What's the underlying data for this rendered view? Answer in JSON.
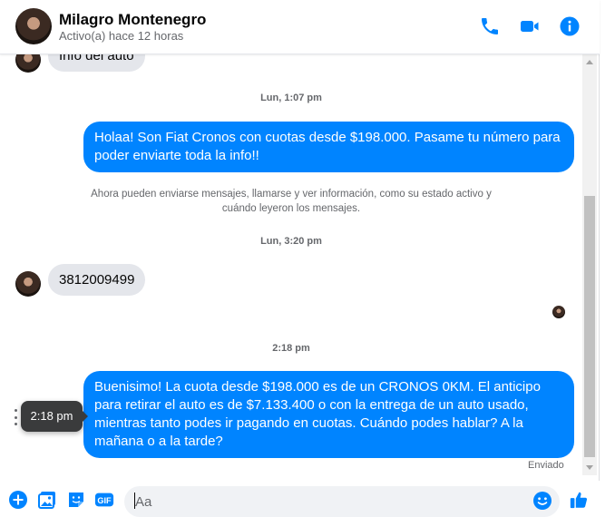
{
  "contact": {
    "name": "Milagro Montenegro",
    "status": "Activo(a) hace 12 horas"
  },
  "header_icons": [
    "phone-icon",
    "video-camera-icon",
    "info-icon"
  ],
  "colors": {
    "accent": "#0084ff",
    "incoming_bubble": "#e4e6eb",
    "muted_text": "#65676b"
  },
  "messages": {
    "top_partial": "Info del auto",
    "ts1": "Lun, 1:07 pm",
    "out1": "Holaa! Son Fiat Cronos con cuotas desde $198.000. Pasame tu número para poder enviarte toda la info!!",
    "notice": "Ahora pueden enviarse mensajes, llamarse y ver información, como su estado activo y cuándo leyeron los mensajes.",
    "ts2": "Lun, 3:20 pm",
    "in1": "3812009499",
    "ts3": "2:18 pm",
    "out2": "Buenisimo! La cuota desde $198.000 es de un CRONOS 0KM. El anticipo para retirar el auto es de $7.133.400 o con la entrega de un auto usado, mientras tanto podes ir pagando en cuotas. Cuándo podes hablar? A la mañana o a la tarde?",
    "tooltip": "2:18 pm",
    "sent_status": "Enviado"
  },
  "composer": {
    "placeholder": "Aa",
    "icons": [
      "plus-icon",
      "photo-icon",
      "sticker-icon",
      "gif-icon",
      "emoji-icon",
      "like-icon"
    ],
    "gif_label": "GIF"
  }
}
